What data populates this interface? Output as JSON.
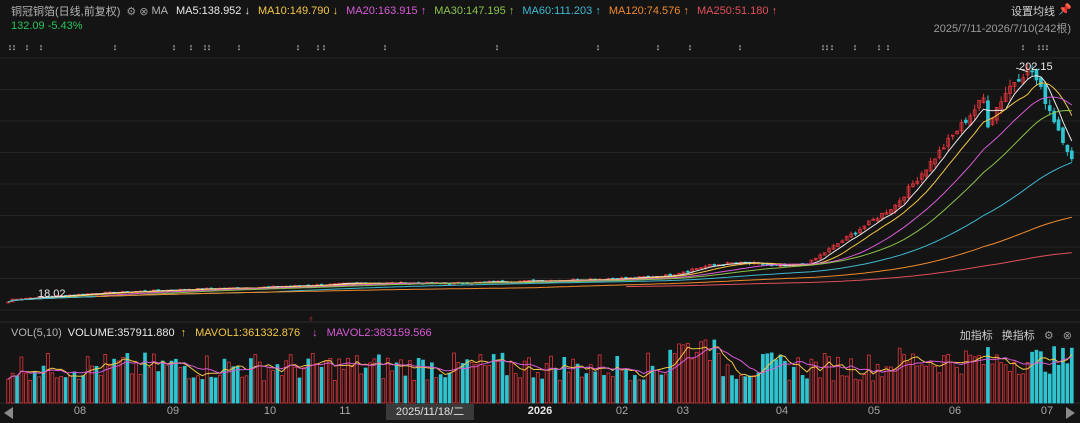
{
  "header": {
    "stock_name": "铜冠铜箔(日线,前复权)",
    "ma_label": "MA",
    "ma_items": [
      {
        "label": "MA5:138.952",
        "arrow": "↓",
        "color": "#e8e8e8"
      },
      {
        "label": "MA10:149.790",
        "arrow": "↓",
        "color": "#f2c744"
      },
      {
        "label": "MA20:163.915",
        "arrow": "↑",
        "color": "#d85ad8"
      },
      {
        "label": "MA30:147.195",
        "arrow": "↑",
        "color": "#8bc34a"
      },
      {
        "label": "MA60:111.203",
        "arrow": "↑",
        "color": "#3fb8d0"
      },
      {
        "label": "MA120:74.576",
        "arrow": "↑",
        "color": "#f08a2c"
      },
      {
        "label": "MA250:51.180",
        "arrow": "↑",
        "color": "#e0505a"
      }
    ],
    "price_change": "132.09 -5.43%",
    "settings_label": "设置均线",
    "date_range": "2025/7/11-2026/7/10(242根)"
  },
  "annotations": {
    "high_label": "202.15",
    "low_label": "18.02",
    "marker_char": "↕"
  },
  "volume_header": {
    "label": "VOL(5,10)",
    "volume": "VOLUME:357911.880",
    "mavol1": "MAVOL1:361332.876",
    "mavol1_arrow": "↑",
    "mavol2": "MAVOL2:383159.566",
    "mavol2_arrow": "↓",
    "add_indicator": "加指标",
    "switch_indicator": "换指标"
  },
  "x_axis": {
    "labels": [
      "08",
      "09",
      "10",
      "11",
      "2026",
      "02",
      "03",
      "04",
      "05",
      "06",
      "07"
    ],
    "crosshair_label": "2025/11/18/二"
  },
  "colors": {
    "up": "#e0353b",
    "down": "#2fc4d0",
    "ma5": "#e8e8e8",
    "ma10": "#f2c744",
    "ma20": "#d85ad8",
    "ma30": "#8bc34a",
    "ma60": "#3fb8d0",
    "ma120": "#f08a2c",
    "ma250": "#e0505a"
  },
  "chart_data": {
    "type": "candlestick",
    "title": "铜冠铜箔(日线,前复权)",
    "period": "2025/7/11-2026/7/10",
    "bar_count": 242,
    "price_high": 202.15,
    "price_low": 18.02,
    "last_close": 132.09,
    "last_change_pct": -5.43,
    "moving_averages": {
      "MA5": 138.952,
      "MA10": 149.79,
      "MA20": 163.915,
      "MA30": 147.195,
      "MA60": 111.203,
      "MA120": 74.576,
      "MA250": 51.18
    },
    "approx_monthly_close": [
      {
        "month": "2025-07",
        "close": 20
      },
      {
        "month": "2025-08",
        "close": 25
      },
      {
        "month": "2025-09",
        "close": 28
      },
      {
        "month": "2025-10",
        "close": 30
      },
      {
        "month": "2025-11",
        "close": 33
      },
      {
        "month": "2025-12",
        "close": 33
      },
      {
        "month": "2026-01",
        "close": 35
      },
      {
        "month": "2026-02",
        "close": 37
      },
      {
        "month": "2026-03",
        "close": 42
      },
      {
        "month": "2026-04",
        "close": 48
      },
      {
        "month": "2026-05",
        "close": 95
      },
      {
        "month": "2026-06",
        "close": 180
      },
      {
        "month": "2026-07",
        "close": 132.09
      }
    ],
    "volume": {
      "VOLUME": 357911.88,
      "MAVOL1": 361332.876,
      "MAVOL2": 383159.566
    }
  }
}
